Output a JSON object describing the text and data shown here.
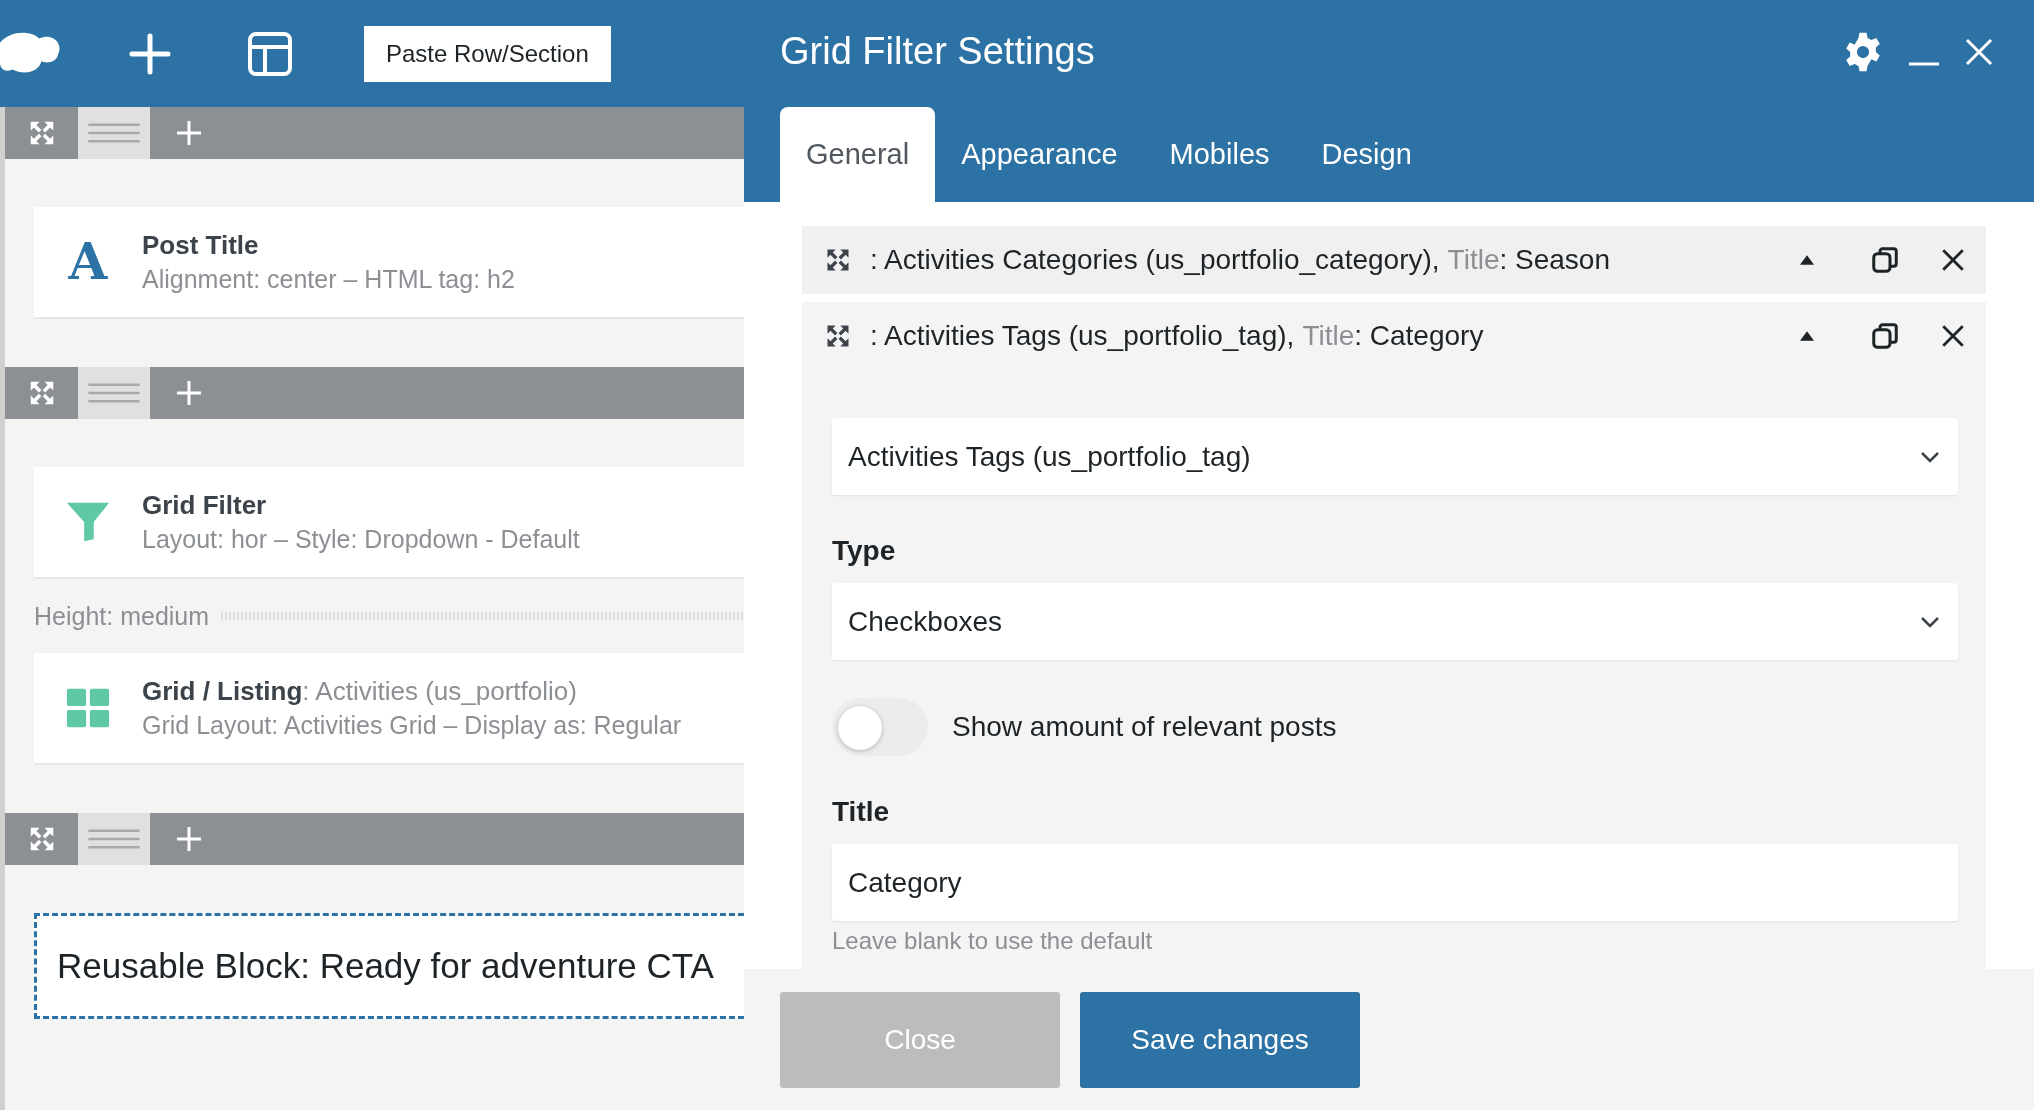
{
  "toolbar": {
    "paste_button": "Paste Row/Section"
  },
  "rows": [
    {
      "elements": [
        {
          "kind": "text-element",
          "glyph": "A",
          "title": "Post Title",
          "desc": "Alignment: center – HTML tag: h2"
        }
      ]
    },
    {
      "elements": [
        {
          "kind": "filter-element",
          "title": "Grid Filter",
          "desc": "Layout: hor – Style: Dropdown - Default"
        },
        {
          "kind": "spacer",
          "label": "Height: medium"
        },
        {
          "kind": "grid-element",
          "title": "Grid / Listing",
          "suffix": ": Activities (us_portfolio)",
          "desc": "Grid Layout: Activities Grid – Display as: Regular"
        }
      ]
    },
    {
      "elements": [
        {
          "kind": "reusable",
          "title": "Reusable Block: Ready for adventure CTA"
        }
      ]
    }
  ],
  "dialog": {
    "title": "Grid Filter Settings",
    "tabs": [
      {
        "label": "General",
        "selected": true
      },
      {
        "label": "Appearance",
        "selected": false
      },
      {
        "label": "Mobiles",
        "selected": false
      },
      {
        "label": "Design",
        "selected": false
      }
    ],
    "filters": [
      {
        "source": ": Activities Categories (us_portfolio_category),",
        "title_key": "Title",
        "title_value": ": Season"
      },
      {
        "source": ": Activities Tags (us_portfolio_tag),",
        "title_key": "Title",
        "title_value": ": Category",
        "settings": {
          "source_select": "Activities Tags (us_portfolio_tag)",
          "type_label": "Type",
          "type_select": "Checkboxes",
          "toggle": {
            "label": "Show amount of relevant posts",
            "on": false
          },
          "title_label": "Title",
          "title_value": "Category",
          "title_hint": "Leave blank to use the default"
        }
      }
    ],
    "buttons": [
      {
        "label": "Close",
        "kind": "secondary"
      },
      {
        "label": "Save changes",
        "kind": "primary"
      }
    ]
  }
}
